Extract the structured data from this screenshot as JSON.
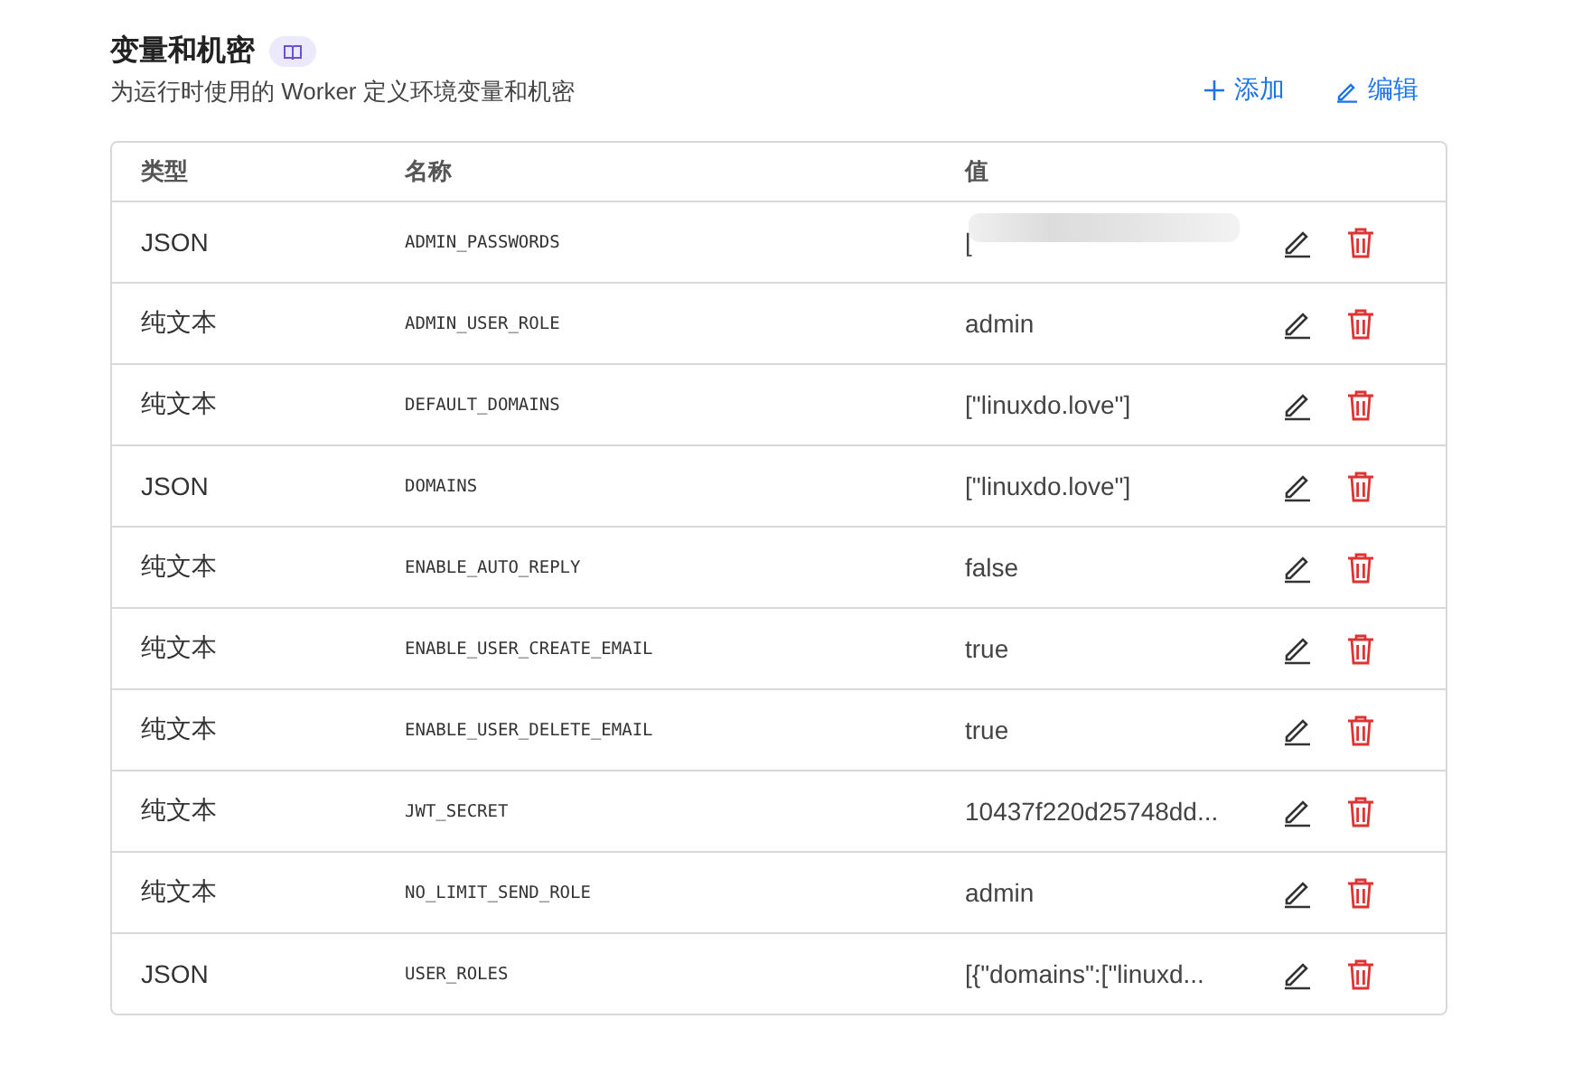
{
  "header": {
    "title": "变量和机密",
    "subtitle": "为运行时使用的 Worker 定义环境变量和机密",
    "actions": [
      {
        "kind": "add",
        "label": "添加"
      },
      {
        "kind": "edit",
        "label": "编辑"
      }
    ]
  },
  "table": {
    "columns": [
      "类型",
      "名称",
      "值"
    ],
    "rows": [
      {
        "type": "JSON",
        "name": "ADMIN_PASSWORDS",
        "value": "[",
        "redacted": true
      },
      {
        "type": "纯文本",
        "name": "ADMIN_USER_ROLE",
        "value": "admin",
        "redacted": false
      },
      {
        "type": "纯文本",
        "name": "DEFAULT_DOMAINS",
        "value": "[\"linuxdo.love\"]",
        "redacted": false
      },
      {
        "type": "JSON",
        "name": "DOMAINS",
        "value": "[\"linuxdo.love\"]",
        "redacted": false
      },
      {
        "type": "纯文本",
        "name": "ENABLE_AUTO_REPLY",
        "value": "false",
        "redacted": false
      },
      {
        "type": "纯文本",
        "name": "ENABLE_USER_CREATE_EMAIL",
        "value": "true",
        "redacted": false
      },
      {
        "type": "纯文本",
        "name": "ENABLE_USER_DELETE_EMAIL",
        "value": "true",
        "redacted": false
      },
      {
        "type": "纯文本",
        "name": "JWT_SECRET",
        "value": "10437f220d25748dd...",
        "redacted": false
      },
      {
        "type": "纯文本",
        "name": "NO_LIMIT_SEND_ROLE",
        "value": "admin",
        "redacted": false
      },
      {
        "type": "JSON",
        "name": "USER_ROLES",
        "value": "[{\"domains\":[\"linuxd...",
        "redacted": false
      }
    ]
  }
}
